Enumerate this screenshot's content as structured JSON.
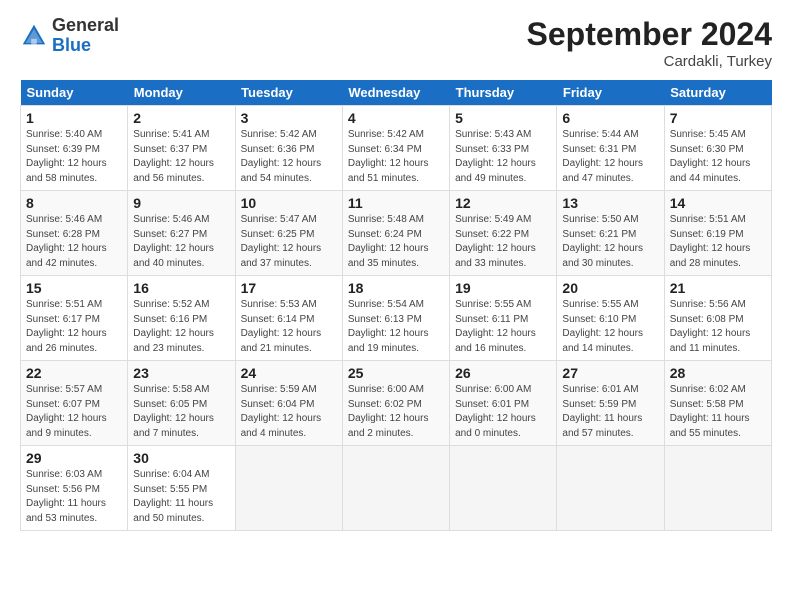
{
  "logo": {
    "general": "General",
    "blue": "Blue"
  },
  "header": {
    "month": "September 2024",
    "location": "Cardakli, Turkey"
  },
  "weekdays": [
    "Sunday",
    "Monday",
    "Tuesday",
    "Wednesday",
    "Thursday",
    "Friday",
    "Saturday"
  ],
  "rows": [
    [
      {
        "day": "1",
        "sunrise": "5:40 AM",
        "sunset": "6:39 PM",
        "daylight": "12 hours and 58 minutes."
      },
      {
        "day": "2",
        "sunrise": "5:41 AM",
        "sunset": "6:37 PM",
        "daylight": "12 hours and 56 minutes."
      },
      {
        "day": "3",
        "sunrise": "5:42 AM",
        "sunset": "6:36 PM",
        "daylight": "12 hours and 54 minutes."
      },
      {
        "day": "4",
        "sunrise": "5:42 AM",
        "sunset": "6:34 PM",
        "daylight": "12 hours and 51 minutes."
      },
      {
        "day": "5",
        "sunrise": "5:43 AM",
        "sunset": "6:33 PM",
        "daylight": "12 hours and 49 minutes."
      },
      {
        "day": "6",
        "sunrise": "5:44 AM",
        "sunset": "6:31 PM",
        "daylight": "12 hours and 47 minutes."
      },
      {
        "day": "7",
        "sunrise": "5:45 AM",
        "sunset": "6:30 PM",
        "daylight": "12 hours and 44 minutes."
      }
    ],
    [
      {
        "day": "8",
        "sunrise": "5:46 AM",
        "sunset": "6:28 PM",
        "daylight": "12 hours and 42 minutes."
      },
      {
        "day": "9",
        "sunrise": "5:46 AM",
        "sunset": "6:27 PM",
        "daylight": "12 hours and 40 minutes."
      },
      {
        "day": "10",
        "sunrise": "5:47 AM",
        "sunset": "6:25 PM",
        "daylight": "12 hours and 37 minutes."
      },
      {
        "day": "11",
        "sunrise": "5:48 AM",
        "sunset": "6:24 PM",
        "daylight": "12 hours and 35 minutes."
      },
      {
        "day": "12",
        "sunrise": "5:49 AM",
        "sunset": "6:22 PM",
        "daylight": "12 hours and 33 minutes."
      },
      {
        "day": "13",
        "sunrise": "5:50 AM",
        "sunset": "6:21 PM",
        "daylight": "12 hours and 30 minutes."
      },
      {
        "day": "14",
        "sunrise": "5:51 AM",
        "sunset": "6:19 PM",
        "daylight": "12 hours and 28 minutes."
      }
    ],
    [
      {
        "day": "15",
        "sunrise": "5:51 AM",
        "sunset": "6:17 PM",
        "daylight": "12 hours and 26 minutes."
      },
      {
        "day": "16",
        "sunrise": "5:52 AM",
        "sunset": "6:16 PM",
        "daylight": "12 hours and 23 minutes."
      },
      {
        "day": "17",
        "sunrise": "5:53 AM",
        "sunset": "6:14 PM",
        "daylight": "12 hours and 21 minutes."
      },
      {
        "day": "18",
        "sunrise": "5:54 AM",
        "sunset": "6:13 PM",
        "daylight": "12 hours and 19 minutes."
      },
      {
        "day": "19",
        "sunrise": "5:55 AM",
        "sunset": "6:11 PM",
        "daylight": "12 hours and 16 minutes."
      },
      {
        "day": "20",
        "sunrise": "5:55 AM",
        "sunset": "6:10 PM",
        "daylight": "12 hours and 14 minutes."
      },
      {
        "day": "21",
        "sunrise": "5:56 AM",
        "sunset": "6:08 PM",
        "daylight": "12 hours and 11 minutes."
      }
    ],
    [
      {
        "day": "22",
        "sunrise": "5:57 AM",
        "sunset": "6:07 PM",
        "daylight": "12 hours and 9 minutes."
      },
      {
        "day": "23",
        "sunrise": "5:58 AM",
        "sunset": "6:05 PM",
        "daylight": "12 hours and 7 minutes."
      },
      {
        "day": "24",
        "sunrise": "5:59 AM",
        "sunset": "6:04 PM",
        "daylight": "12 hours and 4 minutes."
      },
      {
        "day": "25",
        "sunrise": "6:00 AM",
        "sunset": "6:02 PM",
        "daylight": "12 hours and 2 minutes."
      },
      {
        "day": "26",
        "sunrise": "6:00 AM",
        "sunset": "6:01 PM",
        "daylight": "12 hours and 0 minutes."
      },
      {
        "day": "27",
        "sunrise": "6:01 AM",
        "sunset": "5:59 PM",
        "daylight": "11 hours and 57 minutes."
      },
      {
        "day": "28",
        "sunrise": "6:02 AM",
        "sunset": "5:58 PM",
        "daylight": "11 hours and 55 minutes."
      }
    ],
    [
      {
        "day": "29",
        "sunrise": "6:03 AM",
        "sunset": "5:56 PM",
        "daylight": "11 hours and 53 minutes."
      },
      {
        "day": "30",
        "sunrise": "6:04 AM",
        "sunset": "5:55 PM",
        "daylight": "11 hours and 50 minutes."
      },
      null,
      null,
      null,
      null,
      null
    ]
  ]
}
